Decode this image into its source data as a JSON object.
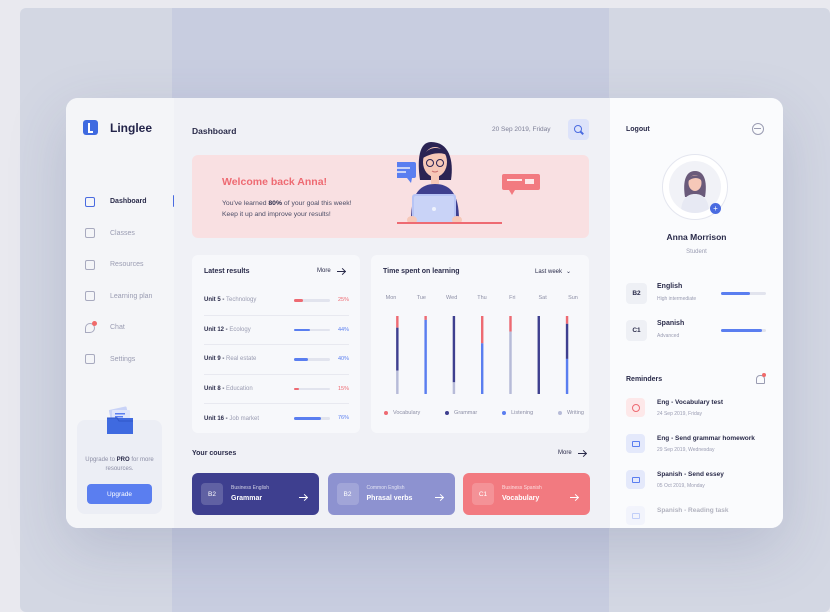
{
  "app": {
    "name": "Linglee"
  },
  "colors": {
    "accent": "#4a6be0",
    "pink": "#ee6a72",
    "navy": "#3e3f8f"
  },
  "sidebar": {
    "items": [
      {
        "label": "Dashboard",
        "icon": "dashboard-icon",
        "active": true
      },
      {
        "label": "Classes",
        "icon": "folder-icon"
      },
      {
        "label": "Resources",
        "icon": "book-icon"
      },
      {
        "label": "Learning plan",
        "icon": "calendar-icon"
      },
      {
        "label": "Chat",
        "icon": "chat-icon",
        "badge": true
      },
      {
        "label": "Settings",
        "icon": "edit-icon"
      }
    ],
    "upgrade": {
      "text_pre": "Upgrade to ",
      "text_bold": "PRO",
      "text_post": " for more resources.",
      "button": "Upgrade"
    }
  },
  "header": {
    "title": "Dashboard",
    "date": "20 Sep 2019, Friday"
  },
  "welcome": {
    "title": "Welcome back Anna!",
    "line1_pre": "You've learned ",
    "line1_bold": "80%",
    "line1_post": " of your goal this week!",
    "line2": "Keep it up and improve your results!"
  },
  "results": {
    "title": "Latest results",
    "more": "More",
    "rows": [
      {
        "unit": "Unit 5",
        "topic": "Technology",
        "pct": "25%",
        "value": 0.25,
        "color": "#ee6a72"
      },
      {
        "unit": "Unit 12",
        "topic": "Ecology",
        "pct": "44%",
        "value": 0.44,
        "color": "#5a7ef0"
      },
      {
        "unit": "Unit 9",
        "topic": "Real estate",
        "pct": "40%",
        "value": 0.4,
        "color": "#5a7ef0"
      },
      {
        "unit": "Unit 8",
        "topic": "Education",
        "pct": "15%",
        "value": 0.15,
        "color": "#ee6a72"
      },
      {
        "unit": "Unit 16",
        "topic": "Job market",
        "pct": "76%",
        "value": 0.76,
        "color": "#5a7ef0"
      }
    ]
  },
  "time": {
    "title": "Time spent on learning",
    "period": "Last week",
    "days": [
      "Mon",
      "Tue",
      "Wed",
      "Thu",
      "Fri",
      "Sat",
      "Sun"
    ],
    "legend": [
      {
        "label": "Vocabulary",
        "color": "#ee6a72"
      },
      {
        "label": "Grammar",
        "color": "#3e3f8f"
      },
      {
        "label": "Listening",
        "color": "#5a7ef0"
      },
      {
        "label": "Writing",
        "color": "#b7bbd8"
      }
    ]
  },
  "chart_data": {
    "type": "bar",
    "categories": [
      "Mon",
      "Tue",
      "Wed",
      "Thu",
      "Fri",
      "Sat",
      "Sun"
    ],
    "series": [
      {
        "name": "Vocabulary",
        "values": [
          0.15,
          0.05,
          0,
          0.35,
          0.2,
          0,
          0.1
        ]
      },
      {
        "name": "Grammar",
        "values": [
          0.55,
          0,
          0.85,
          0,
          0,
          1,
          0.45
        ]
      },
      {
        "name": "Listening",
        "values": [
          0,
          0.95,
          0,
          0.65,
          0,
          0,
          0.45
        ]
      },
      {
        "name": "Writing",
        "values": [
          0.3,
          0,
          0.15,
          0,
          0.8,
          0,
          0
        ]
      }
    ]
  },
  "courses": {
    "title": "Your courses",
    "more": "More",
    "items": [
      {
        "level": "B2",
        "category": "Business English",
        "name": "Grammar",
        "color": "#3e3f8f"
      },
      {
        "level": "B2",
        "category": "Common English",
        "name": "Phrasal verbs",
        "color": "#8d92d0"
      },
      {
        "level": "C1",
        "category": "Business Spanish",
        "name": "Vocabulary",
        "color": "#f27a80"
      }
    ]
  },
  "profile": {
    "logout": "Logout",
    "name": "Anna Morrison",
    "role": "Student",
    "languages": [
      {
        "level": "B2",
        "name": "English",
        "detail": "High intermediate",
        "progress": 0.65
      },
      {
        "level": "C1",
        "name": "Spanish",
        "detail": "Advanced",
        "progress": 0.9
      }
    ]
  },
  "reminders": {
    "title": "Reminders",
    "items": [
      {
        "title": "Eng - Vocabulary test",
        "date": "24 Sep 2019, Friday",
        "icon": "alert-icon",
        "color": "#ee6a72",
        "bg": "#fde8e9"
      },
      {
        "title": "Eng - Send grammar homework",
        "date": "29 Sep 2019, Wednesday",
        "icon": "mail-icon",
        "color": "#5a7ef0",
        "bg": "#e4e9fb"
      },
      {
        "title": "Spanish - Send essey",
        "date": "05 Oct 2019, Monday",
        "icon": "mail-icon",
        "color": "#5a7ef0",
        "bg": "#e4e9fb"
      },
      {
        "title": "Spanish - Reading task",
        "date": "",
        "icon": "mail-icon",
        "color": "#5a7ef0",
        "bg": "#e4e9fb",
        "faded": true
      }
    ]
  }
}
